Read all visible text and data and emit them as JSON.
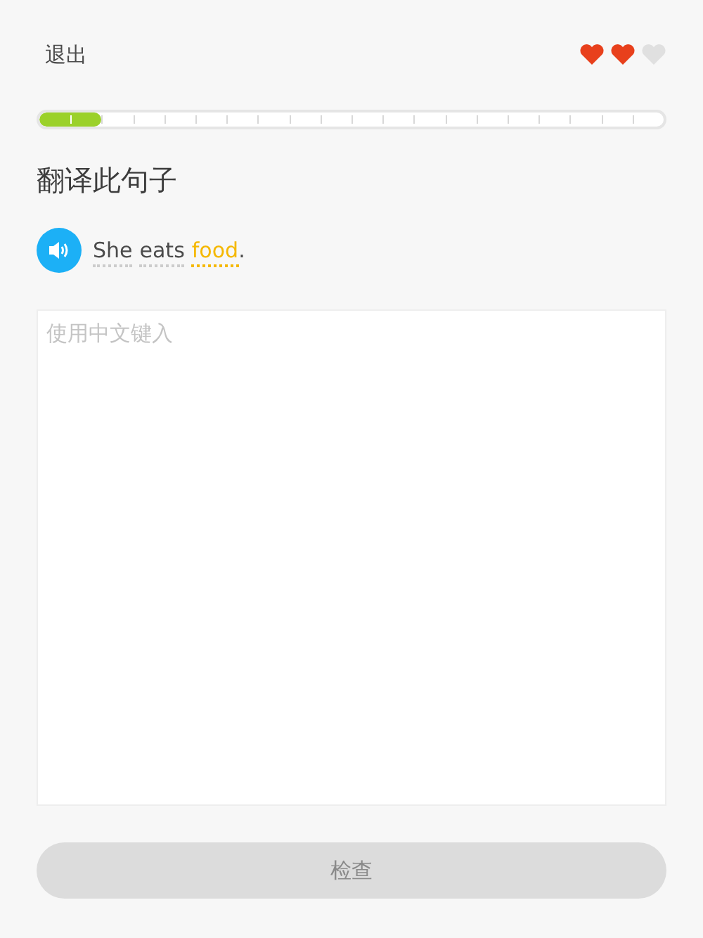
{
  "header": {
    "quit": "退出",
    "hearts": [
      {
        "filled": true
      },
      {
        "filled": true
      },
      {
        "filled": false
      }
    ]
  },
  "progress": {
    "level": 0.1
  },
  "title": "翻译此句子",
  "sentence": {
    "words": [
      {
        "text": "She",
        "highlighted": false
      },
      {
        "text": "eats",
        "highlighted": false
      },
      {
        "text": "food",
        "highlighted": true
      }
    ],
    "end": "."
  },
  "answer": {
    "placeholder": "使用中文键入"
  },
  "check_button": {
    "label": "检查",
    "disabled": true
  }
}
